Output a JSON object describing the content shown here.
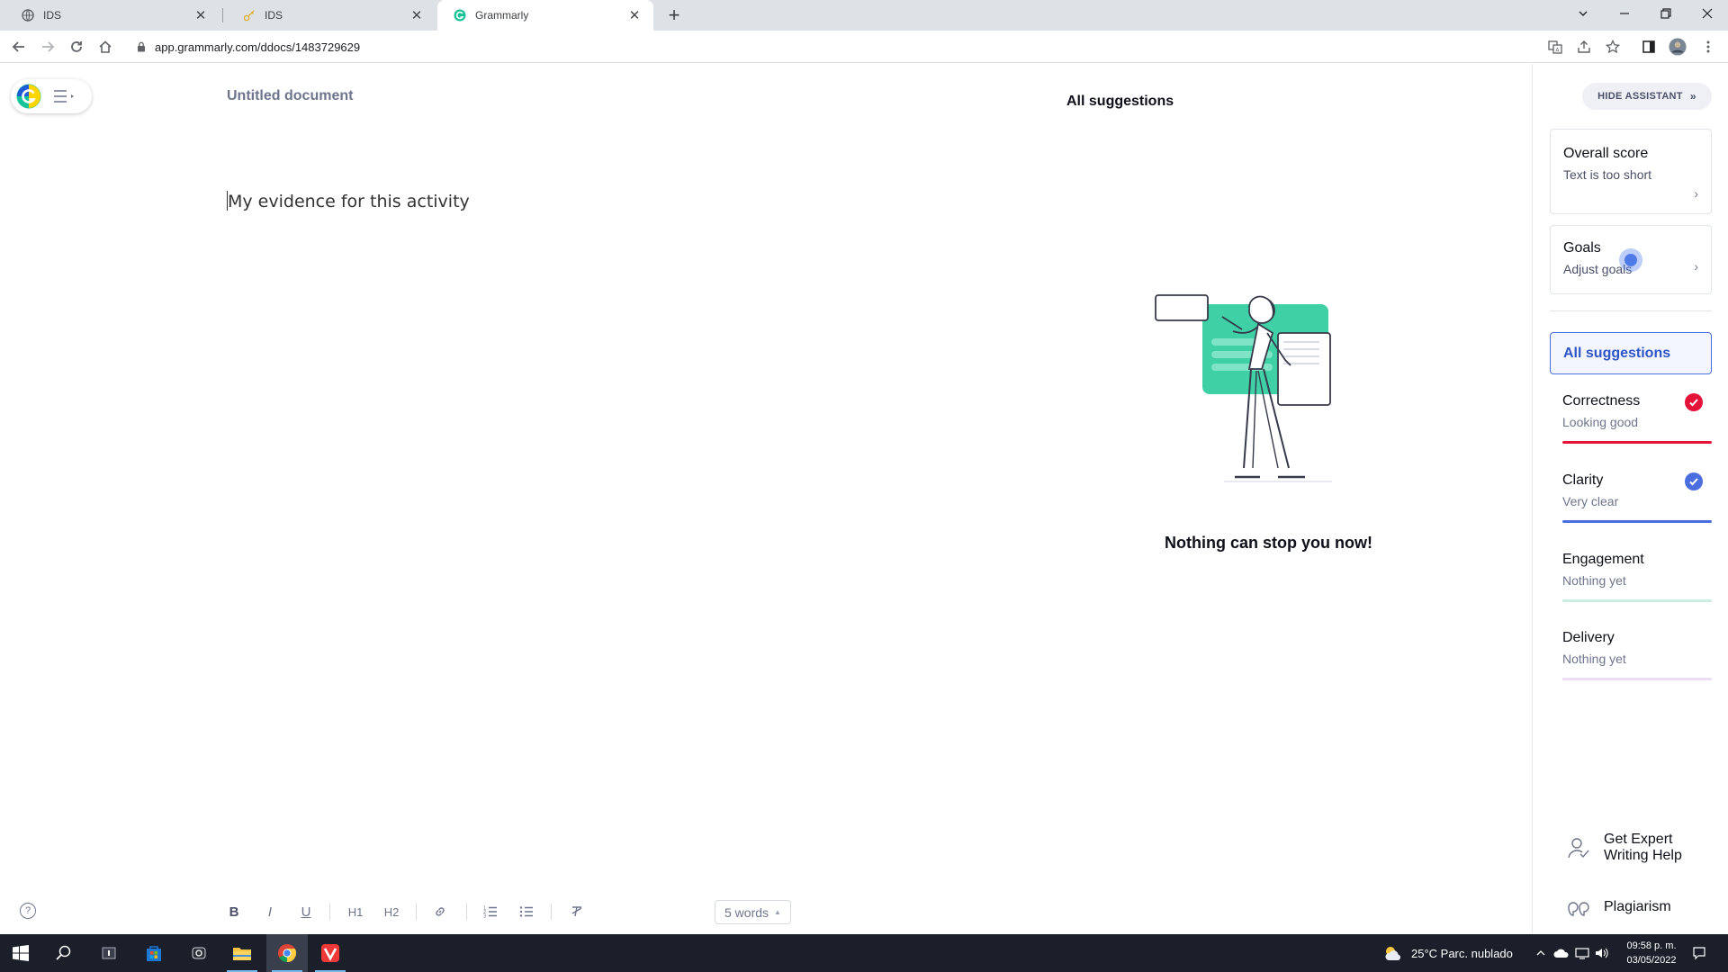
{
  "browser": {
    "tabs": [
      {
        "title": "IDS",
        "active": false
      },
      {
        "title": "IDS",
        "active": false
      },
      {
        "title": "Grammarly",
        "active": true
      }
    ],
    "url": "app.grammarly.com/ddocs/1483729629"
  },
  "editor": {
    "doc_title": "Untitled document",
    "body_text": "My evidence for this activity",
    "word_count": "5 words",
    "format_buttons": [
      "B",
      "I",
      "U",
      "H1",
      "H2"
    ]
  },
  "suggestions_panel": {
    "heading": "All suggestions",
    "empty_message": "Nothing can stop you now!"
  },
  "assistant": {
    "hide_label": "HIDE ASSISTANT",
    "overall": {
      "title": "Overall score",
      "subtitle": "Text is too short"
    },
    "goals": {
      "title": "Goals",
      "subtitle": "Adjust goals"
    },
    "all_suggestions": "All suggestions",
    "categories": [
      {
        "title": "Correctness",
        "status": "Looking good",
        "color": "#e5133a",
        "checked": true
      },
      {
        "title": "Clarity",
        "status": "Very clear",
        "color": "#4a6ee0",
        "checked": true
      },
      {
        "title": "Engagement",
        "status": "Nothing yet",
        "color": "#cbeee2",
        "checked": false
      },
      {
        "title": "Delivery",
        "status": "Nothing yet",
        "color": "#ecdcf6",
        "checked": false
      }
    ],
    "expert_help": "Get Expert Writing Help",
    "expert_help_line1": "Get Expert",
    "expert_help_line2": "Writing Help",
    "plagiarism": "Plagiarism"
  },
  "taskbar": {
    "weather": "25°C  Parc. nublado",
    "time": "09:58 p. m.",
    "date": "03/05/2022"
  }
}
